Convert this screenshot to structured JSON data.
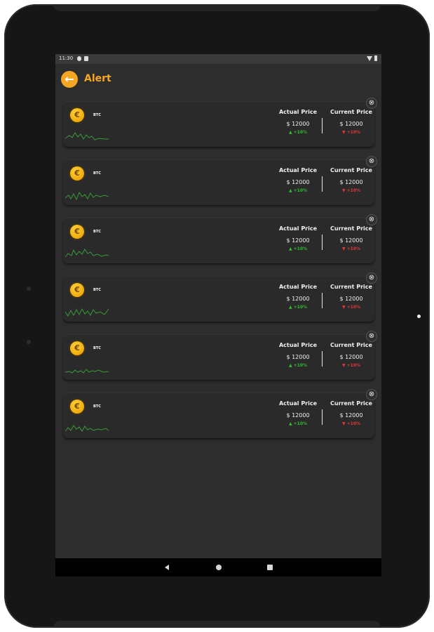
{
  "status_bar": {
    "time": "11:30"
  },
  "header": {
    "back_icon": "arrow-left-icon",
    "title": "Alert"
  },
  "labels": {
    "actual_price": "Actual Price",
    "current_price": "Current Price"
  },
  "alerts": [
    {
      "symbol": "BTC",
      "coin_glyph": "€",
      "actual_price": "$ 12000",
      "actual_change": "▲ +10%",
      "current_price": "$ 12000",
      "current_change": "▼ +10%"
    },
    {
      "symbol": "BTC",
      "coin_glyph": "€",
      "actual_price": "$ 12000",
      "actual_change": "▲ +10%",
      "current_price": "$ 12000",
      "current_change": "▼ +10%"
    },
    {
      "symbol": "BTC",
      "coin_glyph": "€",
      "actual_price": "$ 12000",
      "actual_change": "▲ +10%",
      "current_price": "$ 12000",
      "current_change": "▼ +10%"
    },
    {
      "symbol": "BTC",
      "coin_glyph": "€",
      "actual_price": "$ 12000",
      "actual_change": "▲ +10%",
      "current_price": "$ 12000",
      "current_change": "▼ +10%"
    },
    {
      "symbol": "BTC",
      "coin_glyph": "€",
      "actual_price": "$ 12000",
      "actual_change": "▲ +10%",
      "current_price": "$ 12000",
      "current_change": "▼ +10%"
    },
    {
      "symbol": "BTC",
      "coin_glyph": "€",
      "actual_price": "$ 12000",
      "actual_change": "▲ +10%",
      "current_price": "$ 12000",
      "current_change": "▼ +10%"
    }
  ],
  "colors": {
    "accent": "#f5a623",
    "up": "#2fbf2f",
    "down": "#e23a3a",
    "sparkline": "#3a9a3a"
  },
  "nav": {
    "back_icon": "triangle-back-icon",
    "home_icon": "circle-home-icon",
    "recent_icon": "square-recents-icon"
  }
}
